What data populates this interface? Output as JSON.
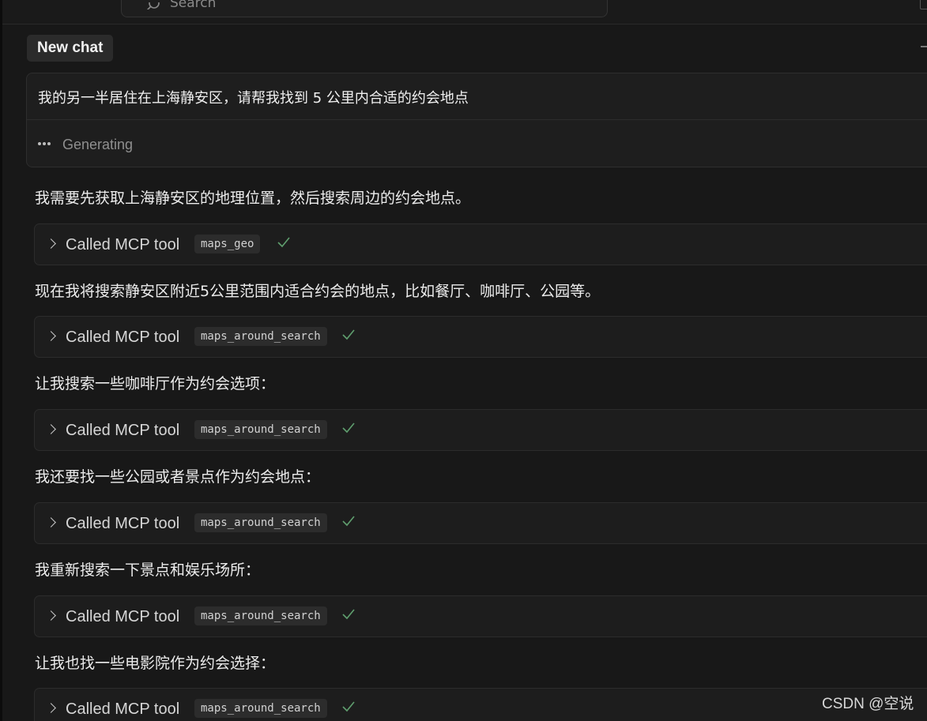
{
  "search": {
    "label": "Search"
  },
  "tab": {
    "title": "New chat"
  },
  "prompt": {
    "text": "我的另一半居住在上海静安区，请帮我找到 5 公里内合适的约会地点",
    "status": "Generating"
  },
  "steps": [
    {
      "message": "我需要先获取上海静安区的地理位置，然后搜索周边的约会地点。",
      "tool_label": "Called MCP tool",
      "tool_name": "maps_geo"
    },
    {
      "message": "现在我将搜索静安区附近5公里范围内适合约会的地点，比如餐厅、咖啡厅、公园等。",
      "tool_label": "Called MCP tool",
      "tool_name": "maps_around_search"
    },
    {
      "message": "让我搜索一些咖啡厅作为约会选项：",
      "tool_label": "Called MCP tool",
      "tool_name": "maps_around_search"
    },
    {
      "message": "我还要找一些公园或者景点作为约会地点：",
      "tool_label": "Called MCP tool",
      "tool_name": "maps_around_search"
    },
    {
      "message": "我重新搜索一下景点和娱乐场所：",
      "tool_label": "Called MCP tool",
      "tool_name": "maps_around_search"
    },
    {
      "message": "让我也找一些电影院作为约会选择：",
      "tool_label": "Called MCP tool",
      "tool_name": "maps_around_search"
    }
  ],
  "watermark": "CSDN @空说",
  "colors": {
    "background": "#181818",
    "card": "#1d1d1d",
    "check": "#5f9e6e"
  }
}
